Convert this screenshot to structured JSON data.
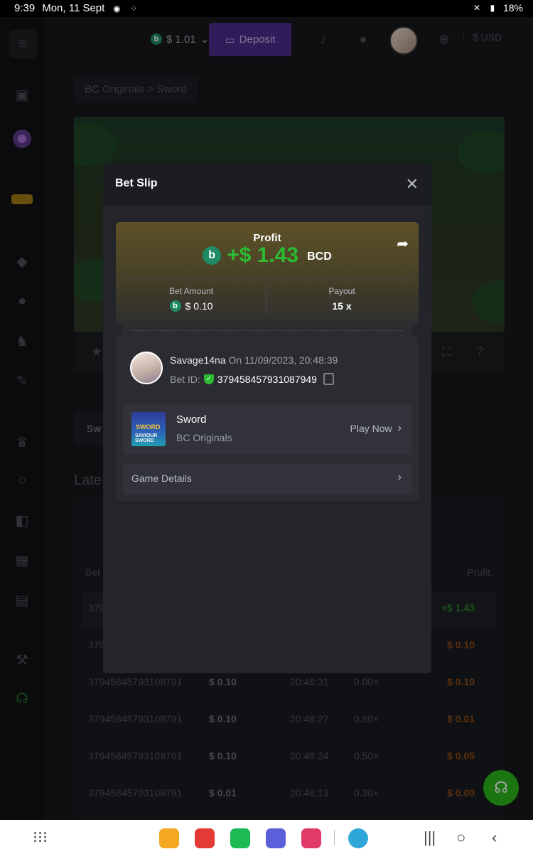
{
  "status_bar": {
    "time": "9:39",
    "date": "Mon, 11 Sept",
    "battery": "18%"
  },
  "header": {
    "balance": "$ 1.01",
    "deposit_label": "Deposit",
    "currency": "$ USD"
  },
  "breadcrumb": {
    "parent": "BC Originals",
    "separator": ">",
    "current": "Sword"
  },
  "background": {
    "tab_label": "Sw",
    "latest_label": "Late",
    "table_header": {
      "bet_id": "Bet",
      "profit": "Profit"
    },
    "rows": [
      {
        "id": "379",
        "bet": "",
        "time": "",
        "payout": "",
        "profit": "+$ 1.43",
        "sign": "pos"
      },
      {
        "id": "379",
        "bet": "",
        "time": "",
        "payout": "",
        "profit": "$ 0.10",
        "sign": "neg"
      },
      {
        "id": "37945845793108791",
        "bet": "$ 0.10",
        "time": "20:48:31",
        "payout": "0.00×",
        "profit": "$ 0.10",
        "sign": "neg"
      },
      {
        "id": "37945845793108791",
        "bet": "$ 0.10",
        "time": "20:48:27",
        "payout": "0.90×",
        "profit": "$ 0.01",
        "sign": "neg"
      },
      {
        "id": "37945845793108791",
        "bet": "$ 0.10",
        "time": "20:48:24",
        "payout": "0.50×",
        "profit": "$ 0.05",
        "sign": "neg"
      },
      {
        "id": "37945845793108791",
        "bet": "$ 0.01",
        "time": "20:48:13",
        "payout": "0.30×",
        "profit": "$ 0.00",
        "sign": "neg"
      }
    ]
  },
  "modal": {
    "title": "Bet Slip",
    "profit_label": "Profit",
    "profit_value": "+$ 1.43",
    "profit_currency": "BCD",
    "bet_amount_label": "Bet Amount",
    "bet_amount_value": "$ 0.10",
    "payout_label": "Payout",
    "payout_value": "15 x",
    "user": {
      "name": "Savage14na",
      "on_text": "On 11/09/2023, 20:48:39",
      "bet_id_label": "Bet ID:",
      "bet_id": "379458457931087949"
    },
    "game": {
      "name": "Sword",
      "provider": "BC Originals",
      "play_label": "Play Now",
      "thumb_title": "SWORD",
      "thumb_sub": "SAVIOUR SWORD"
    },
    "details_label": "Game Details"
  },
  "colors": {
    "profit_green": "#2dbb32",
    "deposit_purple": "#4b2c87",
    "coin_green": "#1f8a64"
  }
}
